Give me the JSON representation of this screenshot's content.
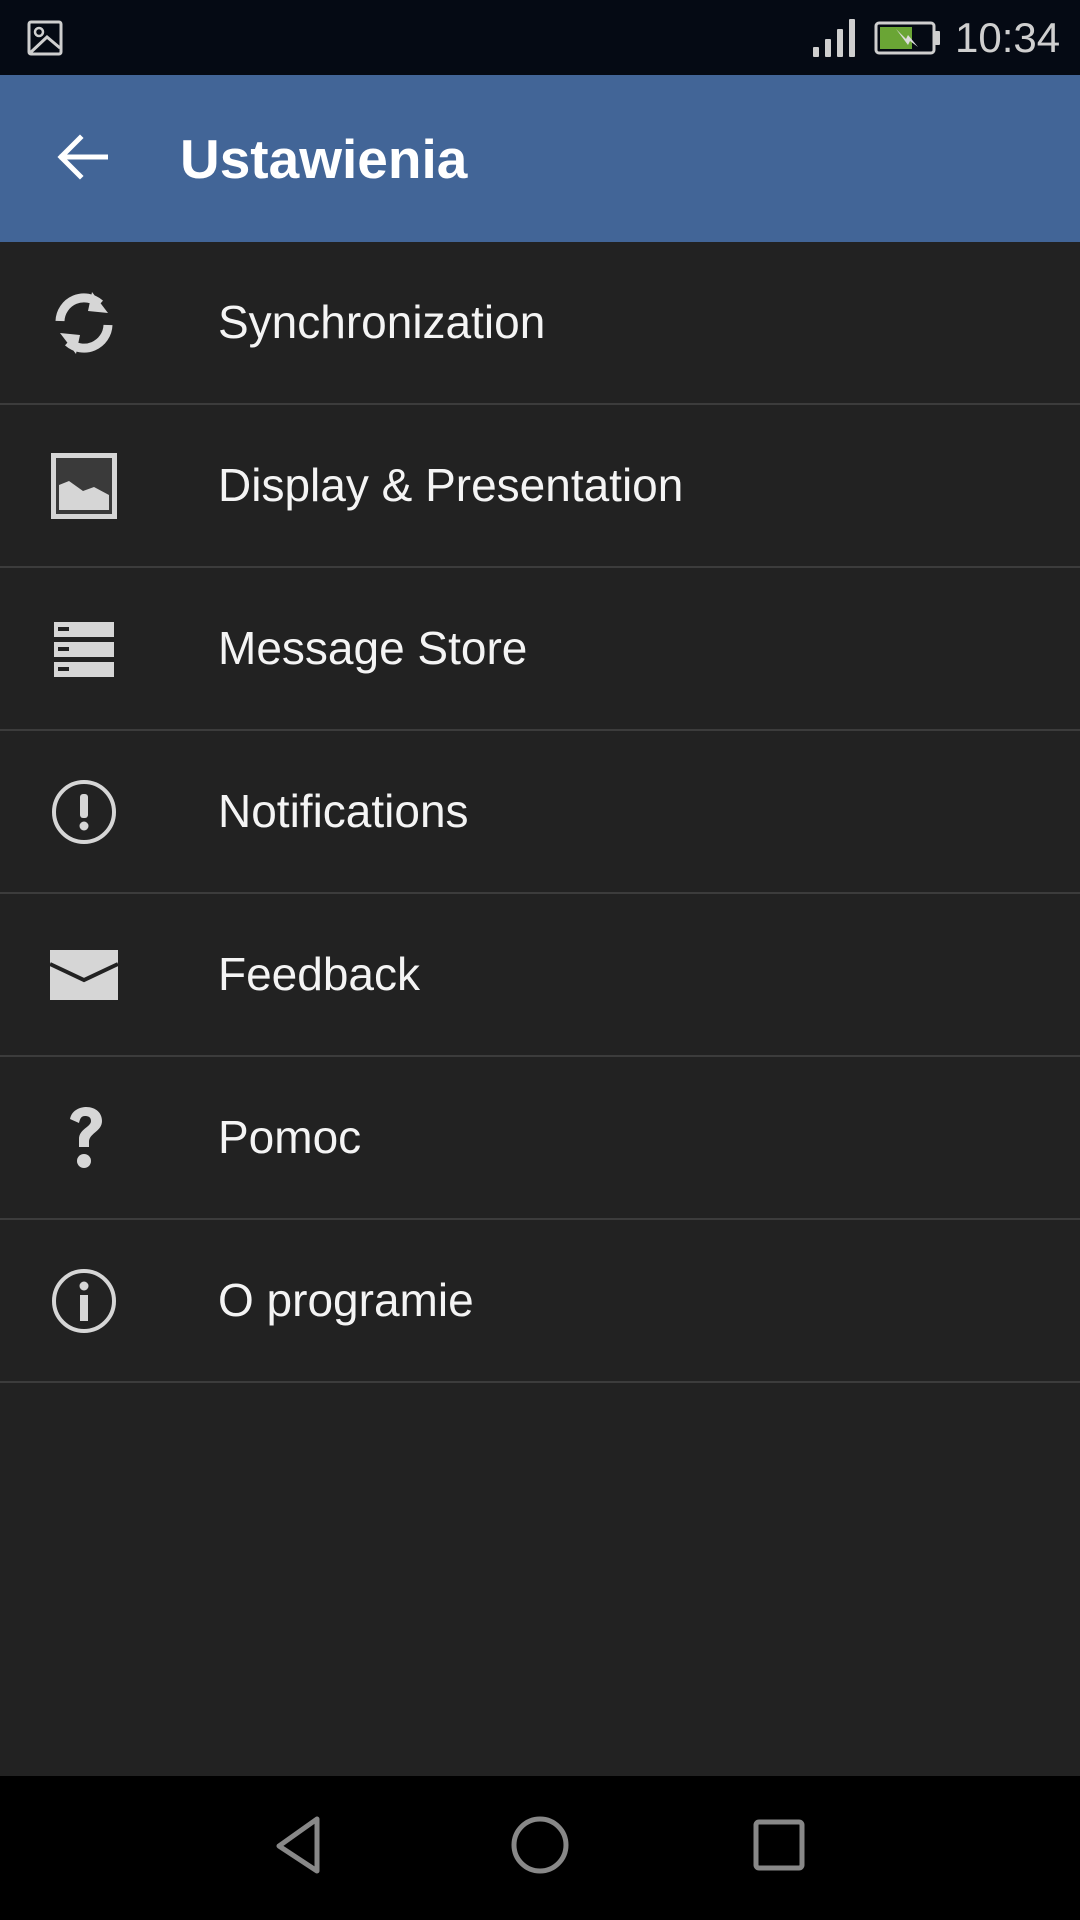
{
  "status_bar": {
    "left_icon": "image-notification-icon",
    "signal_icon": "signal-strength-icon",
    "battery_icon": "battery-charging-icon",
    "battery_color": "#6aa535",
    "time": "10:34"
  },
  "app_bar": {
    "back_icon": "arrow-back-icon",
    "title": "Ustawienia",
    "background_color": "#426597"
  },
  "settings": {
    "items": [
      {
        "label": "Synchronization",
        "icon": "sync-icon"
      },
      {
        "label": "Display & Presentation",
        "icon": "image-icon"
      },
      {
        "label": "Message Store",
        "icon": "storage-icon"
      },
      {
        "label": "Notifications",
        "icon": "alert-circle-icon"
      },
      {
        "label": "Feedback",
        "icon": "mail-icon"
      },
      {
        "label": "Pomoc",
        "icon": "help-icon"
      },
      {
        "label": "O programie",
        "icon": "info-icon"
      }
    ]
  },
  "nav_bar": {
    "back": "nav-back-icon",
    "home": "nav-home-icon",
    "recents": "nav-recents-icon"
  }
}
